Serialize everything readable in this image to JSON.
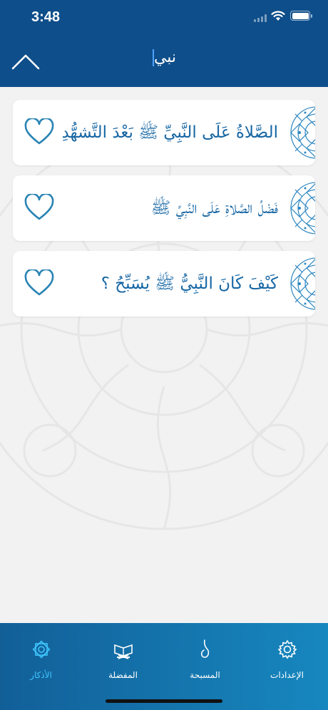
{
  "status_bar": {
    "time": "3:48"
  },
  "header": {
    "search_value": "نبي"
  },
  "results": [
    {
      "title": "الصَّلاةُ عَلَى النَّبِيِّ ﷺ بَعْدَ التَّشهُّدِ"
    },
    {
      "title": "فَضْلُ الصَّلاةِ عَلَى النَّبِيِّ ﷺ"
    },
    {
      "title": "كَيْفَ كَانَ النَّبِيُّ ﷺ يُسَبِّحُ ؟"
    }
  ],
  "tabs": [
    {
      "label": "الإعدادات",
      "icon": "gear-icon"
    },
    {
      "label": "المسبحة",
      "icon": "droplet-icon"
    },
    {
      "label": "المفضلة",
      "icon": "quran-stand-icon"
    },
    {
      "label": "الأذكار",
      "icon": "star-ornament-icon",
      "active": true
    }
  ],
  "colors": {
    "header_bg": "#0e4e8a",
    "accent_text": "#1767a4",
    "heart_stroke": "#2a84b4",
    "tab_active": "#40c7ff"
  }
}
